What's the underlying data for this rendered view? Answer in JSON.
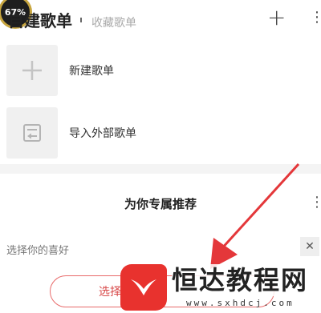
{
  "status": {
    "battery": "67%"
  },
  "header": {
    "tab_created": "自建歌单",
    "tab_collected": "收藏歌单",
    "add_icon": "plus-icon",
    "more_icon": "more-vertical-icon"
  },
  "playlist_items": [
    {
      "label": "新建歌单",
      "icon": "plus-icon"
    },
    {
      "label": "导入外部歌单",
      "icon": "import-icon"
    }
  ],
  "recommend": {
    "title": "为你专属推荐",
    "pref_label": "选择你的喜好",
    "button_label": "选择"
  },
  "watermark": {
    "brand": "恒达教程网",
    "url": "www.sxhdcj.com"
  },
  "colors": {
    "accent": "#e86a6a",
    "arrow": "#e4373a",
    "watermark_red": "#e8322e"
  }
}
